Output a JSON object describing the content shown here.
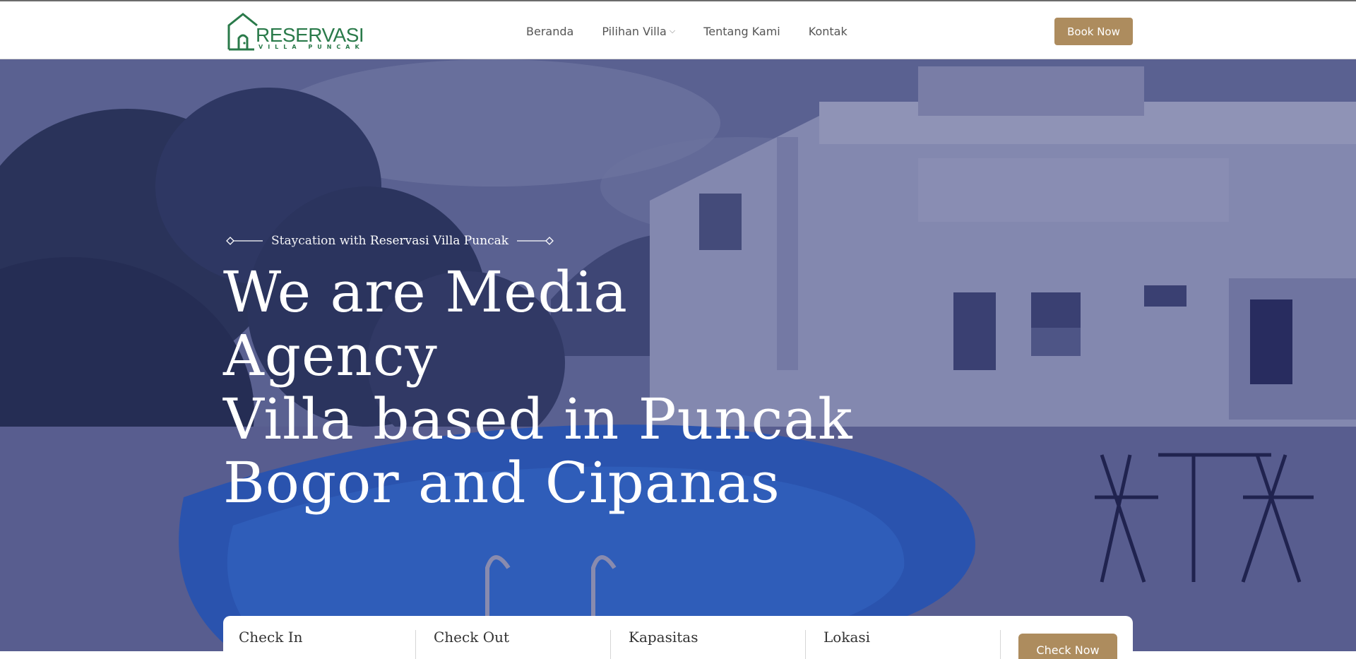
{
  "brand": {
    "name": "RESERVASI",
    "subtitle": "VILLA PUNCAK",
    "color": "#2a7a4a"
  },
  "nav": {
    "items": [
      "Beranda",
      "Pilihan Villa",
      "Tentang Kami",
      "Kontak"
    ],
    "dropdown_icon": "chevron-down-icon"
  },
  "header": {
    "book_label": "Book Now"
  },
  "hero": {
    "tagline_prefix": "Staycation with",
    "tagline_brand": "Reservasi Villa Puncak",
    "title_line1": "We are Media Agency",
    "title_line2": "Villa based in Puncak",
    "title_line3": "Bogor and Cipanas"
  },
  "booking": {
    "fields": [
      "Check In",
      "Check Out",
      "Kapasitas",
      "Lokasi"
    ],
    "button_label": "Check Now"
  },
  "colors": {
    "accent": "#ad8c5e",
    "overlay": "#232869"
  }
}
